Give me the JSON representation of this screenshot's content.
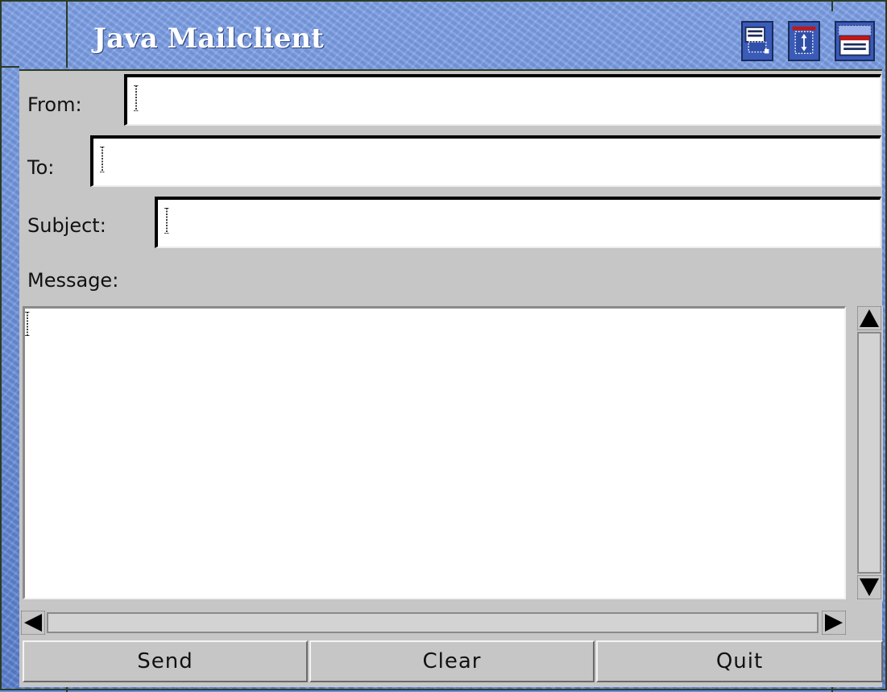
{
  "window": {
    "title": "Java Mailclient",
    "buttons": [
      "window-menu-icon",
      "maximize-vertical-icon",
      "minimize-window-icon"
    ]
  },
  "form": {
    "from_label": "From:",
    "from_value": "",
    "to_label": "To:",
    "to_value": "",
    "subject_label": "Subject:",
    "subject_value": "",
    "message_label": "Message:",
    "message_value": ""
  },
  "buttons": {
    "send": "Send",
    "clear": "Clear",
    "quit": "Quit"
  },
  "colors": {
    "titlebar": "#6b8fd6",
    "client_bg": "#c6c6c6",
    "field_bg": "#ffffff"
  }
}
